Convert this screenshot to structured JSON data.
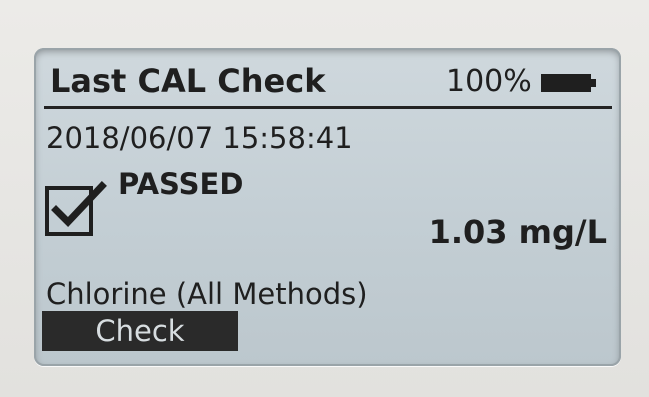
{
  "header": {
    "title": "Last CAL Check",
    "battery_percent": "100%",
    "battery_level": 1.0
  },
  "calibration": {
    "datetime": "2018/06/07  15:58:41",
    "status": "PASSED",
    "checked": true,
    "reading": "1.03 mg/L",
    "method": "Chlorine (All Methods)"
  },
  "softkeys": {
    "left": "Check"
  },
  "colors": {
    "lcd_background": "#c6d0d6",
    "lcd_ink": "#1f1f1f",
    "bezel": "#e7e6e3"
  },
  "icons": {
    "battery": "battery-icon",
    "checkbox": "checkbox-checked-icon"
  }
}
